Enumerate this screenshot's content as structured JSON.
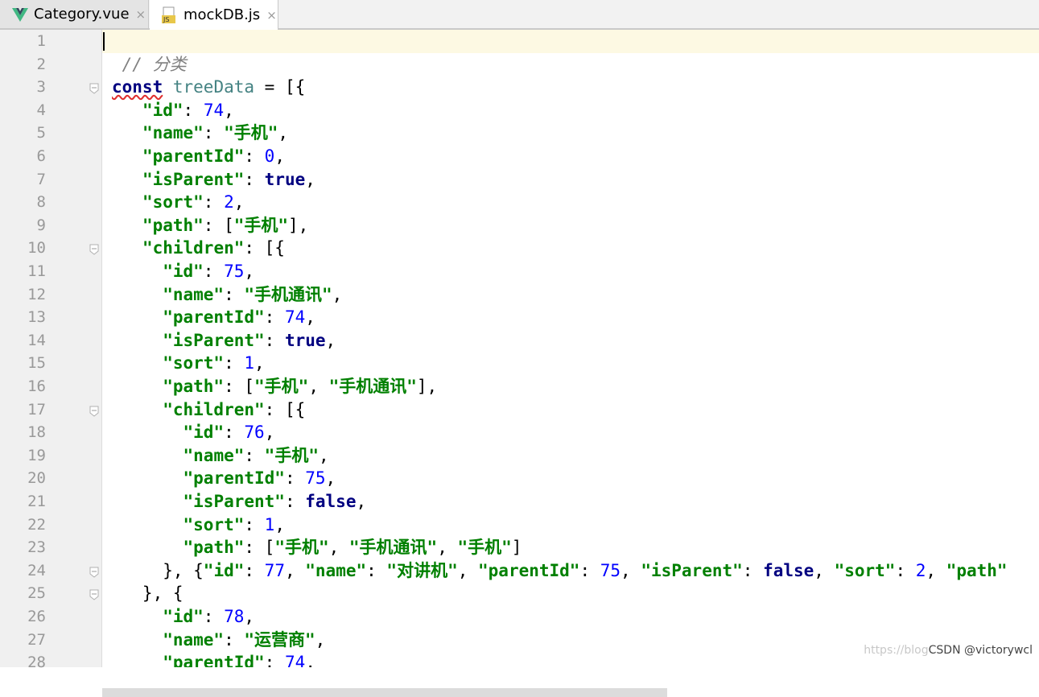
{
  "tabs": [
    {
      "label": "Category.vue",
      "icon": "vue-icon",
      "close": "×"
    },
    {
      "label": "mockDB.js",
      "icon": "js-file-icon",
      "close": "×"
    }
  ],
  "colors": {
    "keyword": "#000080",
    "string": "#008000",
    "number": "#0000ff",
    "comment": "#808080",
    "variable": "#458383",
    "current_line": "#fdf9e3"
  },
  "lines": [
    {
      "n": "1",
      "tokens": []
    },
    {
      "n": "2",
      "tokens": [
        [
          "c",
          " // 分类"
        ]
      ]
    },
    {
      "n": "3",
      "tokens": [
        [
          "k",
          "const"
        ],
        [
          "p",
          " "
        ],
        [
          "v",
          "treeData"
        ],
        [
          "p",
          " = [{"
        ]
      ]
    },
    {
      "n": "4",
      "tokens": [
        [
          "p",
          "   "
        ],
        [
          "s",
          "\"id\""
        ],
        [
          "p",
          ": "
        ],
        [
          "n",
          "74"
        ],
        [
          "p",
          ","
        ]
      ]
    },
    {
      "n": "5",
      "tokens": [
        [
          "p",
          "   "
        ],
        [
          "s",
          "\"name\""
        ],
        [
          "p",
          ": "
        ],
        [
          "s",
          "\"手机\""
        ],
        [
          "p",
          ","
        ]
      ]
    },
    {
      "n": "6",
      "tokens": [
        [
          "p",
          "   "
        ],
        [
          "s",
          "\"parentId\""
        ],
        [
          "p",
          ": "
        ],
        [
          "n",
          "0"
        ],
        [
          "p",
          ","
        ]
      ]
    },
    {
      "n": "7",
      "tokens": [
        [
          "p",
          "   "
        ],
        [
          "s",
          "\"isParent\""
        ],
        [
          "p",
          ": "
        ],
        [
          "k",
          "true"
        ],
        [
          "p",
          ","
        ]
      ]
    },
    {
      "n": "8",
      "tokens": [
        [
          "p",
          "   "
        ],
        [
          "s",
          "\"sort\""
        ],
        [
          "p",
          ": "
        ],
        [
          "n",
          "2"
        ],
        [
          "p",
          ","
        ]
      ]
    },
    {
      "n": "9",
      "tokens": [
        [
          "p",
          "   "
        ],
        [
          "s",
          "\"path\""
        ],
        [
          "p",
          ": ["
        ],
        [
          "s",
          "\"手机\""
        ],
        [
          "p",
          "],"
        ]
      ]
    },
    {
      "n": "10",
      "tokens": [
        [
          "p",
          "   "
        ],
        [
          "s",
          "\"children\""
        ],
        [
          "p",
          ": [{"
        ]
      ]
    },
    {
      "n": "11",
      "tokens": [
        [
          "p",
          "     "
        ],
        [
          "s",
          "\"id\""
        ],
        [
          "p",
          ": "
        ],
        [
          "n",
          "75"
        ],
        [
          "p",
          ","
        ]
      ]
    },
    {
      "n": "12",
      "tokens": [
        [
          "p",
          "     "
        ],
        [
          "s",
          "\"name\""
        ],
        [
          "p",
          ": "
        ],
        [
          "s",
          "\"手机通讯\""
        ],
        [
          "p",
          ","
        ]
      ]
    },
    {
      "n": "13",
      "tokens": [
        [
          "p",
          "     "
        ],
        [
          "s",
          "\"parentId\""
        ],
        [
          "p",
          ": "
        ],
        [
          "n",
          "74"
        ],
        [
          "p",
          ","
        ]
      ]
    },
    {
      "n": "14",
      "tokens": [
        [
          "p",
          "     "
        ],
        [
          "s",
          "\"isParent\""
        ],
        [
          "p",
          ": "
        ],
        [
          "k",
          "true"
        ],
        [
          "p",
          ","
        ]
      ]
    },
    {
      "n": "15",
      "tokens": [
        [
          "p",
          "     "
        ],
        [
          "s",
          "\"sort\""
        ],
        [
          "p",
          ": "
        ],
        [
          "n",
          "1"
        ],
        [
          "p",
          ","
        ]
      ]
    },
    {
      "n": "16",
      "tokens": [
        [
          "p",
          "     "
        ],
        [
          "s",
          "\"path\""
        ],
        [
          "p",
          ": ["
        ],
        [
          "s",
          "\"手机\""
        ],
        [
          "p",
          ", "
        ],
        [
          "s",
          "\"手机通讯\""
        ],
        [
          "p",
          "],"
        ]
      ]
    },
    {
      "n": "17",
      "tokens": [
        [
          "p",
          "     "
        ],
        [
          "s",
          "\"children\""
        ],
        [
          "p",
          ": [{"
        ]
      ]
    },
    {
      "n": "18",
      "tokens": [
        [
          "p",
          "       "
        ],
        [
          "s",
          "\"id\""
        ],
        [
          "p",
          ": "
        ],
        [
          "n",
          "76"
        ],
        [
          "p",
          ","
        ]
      ]
    },
    {
      "n": "19",
      "tokens": [
        [
          "p",
          "       "
        ],
        [
          "s",
          "\"name\""
        ],
        [
          "p",
          ": "
        ],
        [
          "s",
          "\"手机\""
        ],
        [
          "p",
          ","
        ]
      ]
    },
    {
      "n": "20",
      "tokens": [
        [
          "p",
          "       "
        ],
        [
          "s",
          "\"parentId\""
        ],
        [
          "p",
          ": "
        ],
        [
          "n",
          "75"
        ],
        [
          "p",
          ","
        ]
      ]
    },
    {
      "n": "21",
      "tokens": [
        [
          "p",
          "       "
        ],
        [
          "s",
          "\"isParent\""
        ],
        [
          "p",
          ": "
        ],
        [
          "k",
          "false"
        ],
        [
          "p",
          ","
        ]
      ]
    },
    {
      "n": "22",
      "tokens": [
        [
          "p",
          "       "
        ],
        [
          "s",
          "\"sort\""
        ],
        [
          "p",
          ": "
        ],
        [
          "n",
          "1"
        ],
        [
          "p",
          ","
        ]
      ]
    },
    {
      "n": "23",
      "tokens": [
        [
          "p",
          "       "
        ],
        [
          "s",
          "\"path\""
        ],
        [
          "p",
          ": ["
        ],
        [
          "s",
          "\"手机\""
        ],
        [
          "p",
          ", "
        ],
        [
          "s",
          "\"手机通讯\""
        ],
        [
          "p",
          ", "
        ],
        [
          "s",
          "\"手机\""
        ],
        [
          "p",
          "]"
        ]
      ]
    },
    {
      "n": "24",
      "tokens": [
        [
          "p",
          "     }, {"
        ],
        [
          "s",
          "\"id\""
        ],
        [
          "p",
          ": "
        ],
        [
          "n",
          "77"
        ],
        [
          "p",
          ", "
        ],
        [
          "s",
          "\"name\""
        ],
        [
          "p",
          ": "
        ],
        [
          "s",
          "\"对讲机\""
        ],
        [
          "p",
          ", "
        ],
        [
          "s",
          "\"parentId\""
        ],
        [
          "p",
          ": "
        ],
        [
          "n",
          "75"
        ],
        [
          "p",
          ", "
        ],
        [
          "s",
          "\"isParent\""
        ],
        [
          "p",
          ": "
        ],
        [
          "k",
          "false"
        ],
        [
          "p",
          ", "
        ],
        [
          "s",
          "\"sort\""
        ],
        [
          "p",
          ": "
        ],
        [
          "n",
          "2"
        ],
        [
          "p",
          ", "
        ],
        [
          "s",
          "\"path\""
        ]
      ]
    },
    {
      "n": "25",
      "tokens": [
        [
          "p",
          "   }, {"
        ]
      ]
    },
    {
      "n": "26",
      "tokens": [
        [
          "p",
          "     "
        ],
        [
          "s",
          "\"id\""
        ],
        [
          "p",
          ": "
        ],
        [
          "n",
          "78"
        ],
        [
          "p",
          ","
        ]
      ]
    },
    {
      "n": "27",
      "tokens": [
        [
          "p",
          "     "
        ],
        [
          "s",
          "\"name\""
        ],
        [
          "p",
          ": "
        ],
        [
          "s",
          "\"运营商\""
        ],
        [
          "p",
          ","
        ]
      ]
    },
    {
      "n": "28",
      "tokens": [
        [
          "p",
          "     "
        ],
        [
          "s",
          "\"parentId\""
        ],
        [
          "p",
          ": "
        ],
        [
          "n",
          "74"
        ],
        [
          "p",
          ","
        ]
      ]
    }
  ],
  "fold_markers": [
    "3",
    "10",
    "17",
    "24",
    "25"
  ],
  "watermark": {
    "site": "https://blog",
    "author": "CSDN @victorywcl"
  }
}
